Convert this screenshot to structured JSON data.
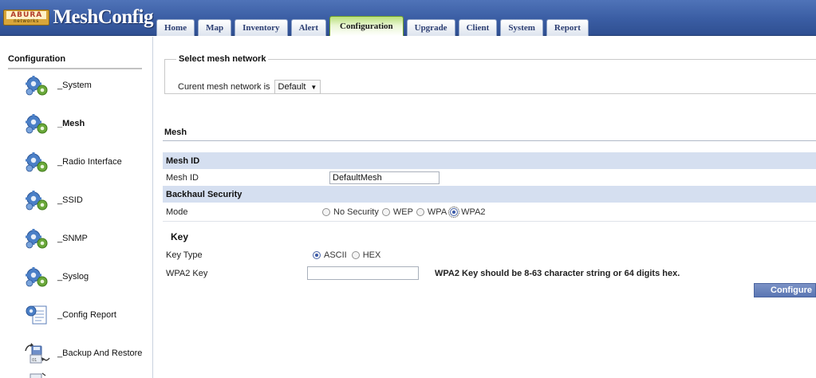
{
  "app": {
    "logo_brand": "ABURA",
    "logo_sub": "networks",
    "title": "MeshConfig"
  },
  "tabs": [
    {
      "label": "Home"
    },
    {
      "label": "Map"
    },
    {
      "label": "Inventory"
    },
    {
      "label": "Alert"
    },
    {
      "label": "Configuration",
      "active": true
    },
    {
      "label": "Upgrade"
    },
    {
      "label": "Client"
    },
    {
      "label": "System"
    },
    {
      "label": "Report"
    }
  ],
  "sidebar": {
    "heading": "Configuration",
    "items": [
      {
        "label": "_System",
        "icon": "gears-icon"
      },
      {
        "label": "_Mesh",
        "icon": "gears-icon",
        "active": true
      },
      {
        "label": "_Radio Interface",
        "icon": "gears-icon"
      },
      {
        "label": "_SSID",
        "icon": "gears-icon"
      },
      {
        "label": "_SNMP",
        "icon": "gears-icon"
      },
      {
        "label": "_Syslog",
        "icon": "gears-icon"
      },
      {
        "label": "_Config Report",
        "icon": "config-report-icon"
      },
      {
        "label": "_Backup And Restore",
        "icon": "backup-restore-icon"
      }
    ]
  },
  "select_mesh": {
    "legend": "Select mesh network",
    "current_label": "Curent mesh network is",
    "current_value": "Default"
  },
  "mesh": {
    "section_title": "Mesh",
    "mesh_id_header": "Mesh ID",
    "mesh_id_label": "Mesh ID",
    "mesh_id_value": "DefaultMesh",
    "backhaul_header": "Backhaul Security",
    "mode_label": "Mode",
    "mode_options": [
      "No Security",
      "WEP",
      "WPA",
      "WPA2"
    ],
    "mode_selected": "WPA2",
    "key_header": "Key",
    "key_type_label": "Key Type",
    "key_type_options": [
      "ASCII",
      "HEX"
    ],
    "key_type_selected": "ASCII",
    "wpa2_key_label": "WPA2 Key",
    "wpa2_key_value": "",
    "wpa2_hint": "WPA2 Key should be 8-63 character string or 64 digits hex.",
    "configure_label": "Configure"
  },
  "colors": {
    "header_blue": "#3a5da3",
    "active_tab_green": "#b8e07a",
    "band_blue": "#d5dff0",
    "button_blue": "#5a76b3"
  }
}
